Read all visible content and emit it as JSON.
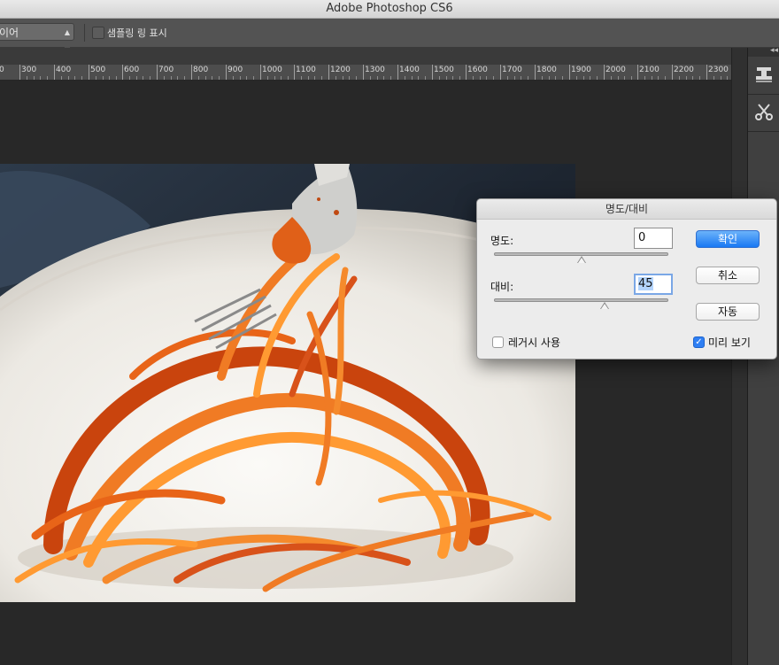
{
  "app": {
    "title": "Adobe Photoshop CS6"
  },
  "options_bar": {
    "sample_select_value": "이어",
    "show_sampling_ring_label": "샘플링 링 표시",
    "show_sampling_ring_checked": false
  },
  "ruler": {
    "labels": [
      "0",
      "300",
      "400",
      "500",
      "600",
      "700",
      "800",
      "900",
      "1000",
      "1100",
      "1200",
      "1300",
      "1400",
      "1500",
      "1600",
      "1700",
      "1800",
      "1900",
      "2000",
      "2100",
      "2200",
      "2300"
    ]
  },
  "image": {
    "subject": "spaghetti-with-tomato-sauce-on-fork"
  },
  "dialog": {
    "title": "명도/대비",
    "brightness": {
      "label": "명도:",
      "value": "0",
      "level": 0,
      "min": -150,
      "max": 150
    },
    "contrast": {
      "label": "대비:",
      "value": "45",
      "level": 45,
      "min": -50,
      "max": 100
    },
    "legacy": {
      "label": "레거시 사용",
      "checked": false
    },
    "preview": {
      "label": "미리 보기",
      "checked": true
    },
    "buttons": {
      "ok": "확인",
      "cancel": "취소",
      "auto": "자동"
    }
  },
  "colors": {
    "accent_blue": "#1978f3",
    "panel_bg": "#535353",
    "canvas_bg": "#282828",
    "dialog_bg": "#ececec"
  }
}
